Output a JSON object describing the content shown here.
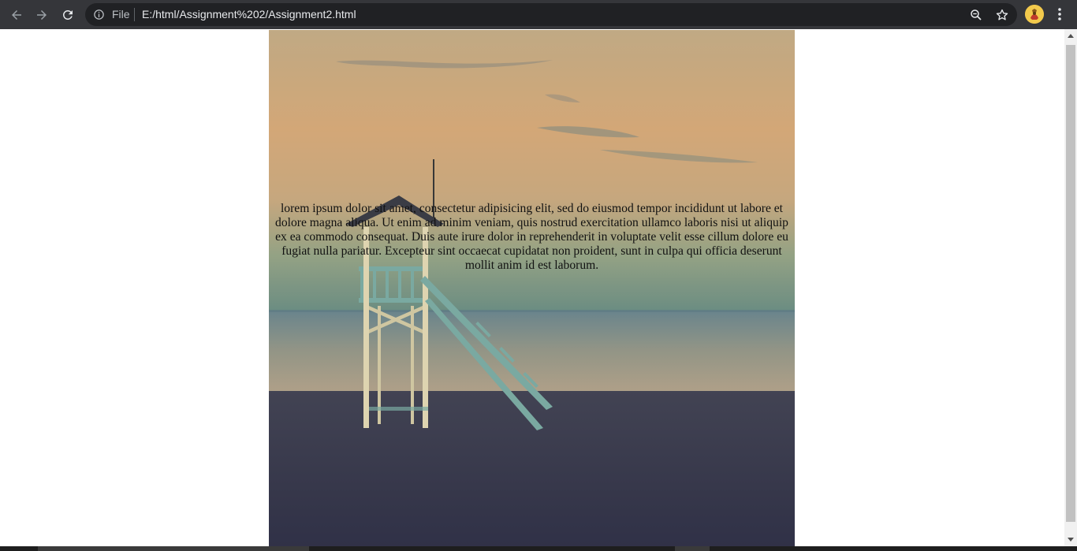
{
  "browser": {
    "scheme_label": "File",
    "url": "E:/html/Assignment%202/Assignment2.html",
    "icons": {
      "back": "arrow-left-icon",
      "forward": "arrow-right-icon",
      "reload": "reload-icon",
      "info": "info-icon",
      "zoom": "zoom-icon",
      "bookmark": "star-icon",
      "menu": "kebab-menu-icon"
    },
    "colors": {
      "toolbar": "#35363a",
      "omnibox": "#202124",
      "avatar": "#f2c94c"
    }
  },
  "page": {
    "paragraph": "lorem ipsum dolor sit amet, consectetur adipisicing elit, sed do eiusmod tempor incididunt ut labore et dolore magna aliqua. Ut enim ad minim veniam, quis nostrud exercitation ullamco laboris nisi ut aliquip ex ea commodo consequat. Duis aute irure dolor in reprehenderit in voluptate velit esse cillum dolore eu fugiat nulla pariatur. Excepteur sint occaecat cupidatat non proident, sunt in culpa qui officia deserunt mollit anim id est laborum."
  }
}
